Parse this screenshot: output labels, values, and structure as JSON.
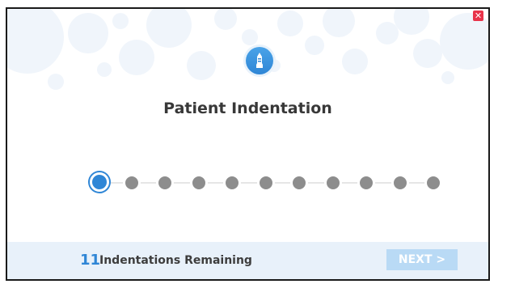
{
  "dialog": {
    "title": "Patient Indentation",
    "close_icon": "close-icon",
    "logo_icon": "probe-icon"
  },
  "progress": {
    "total_steps": 11,
    "current_step": 1
  },
  "footer": {
    "remaining_count": "11",
    "remaining_label": "Indentations Remaining",
    "next_label": "NEXT >"
  },
  "colors": {
    "accent": "#2f86d6",
    "inactive_step": "#8d8d8d",
    "footer_bg": "#e8f1fa",
    "next_bg": "#b9daf5",
    "close_bg": "#e8334a"
  }
}
